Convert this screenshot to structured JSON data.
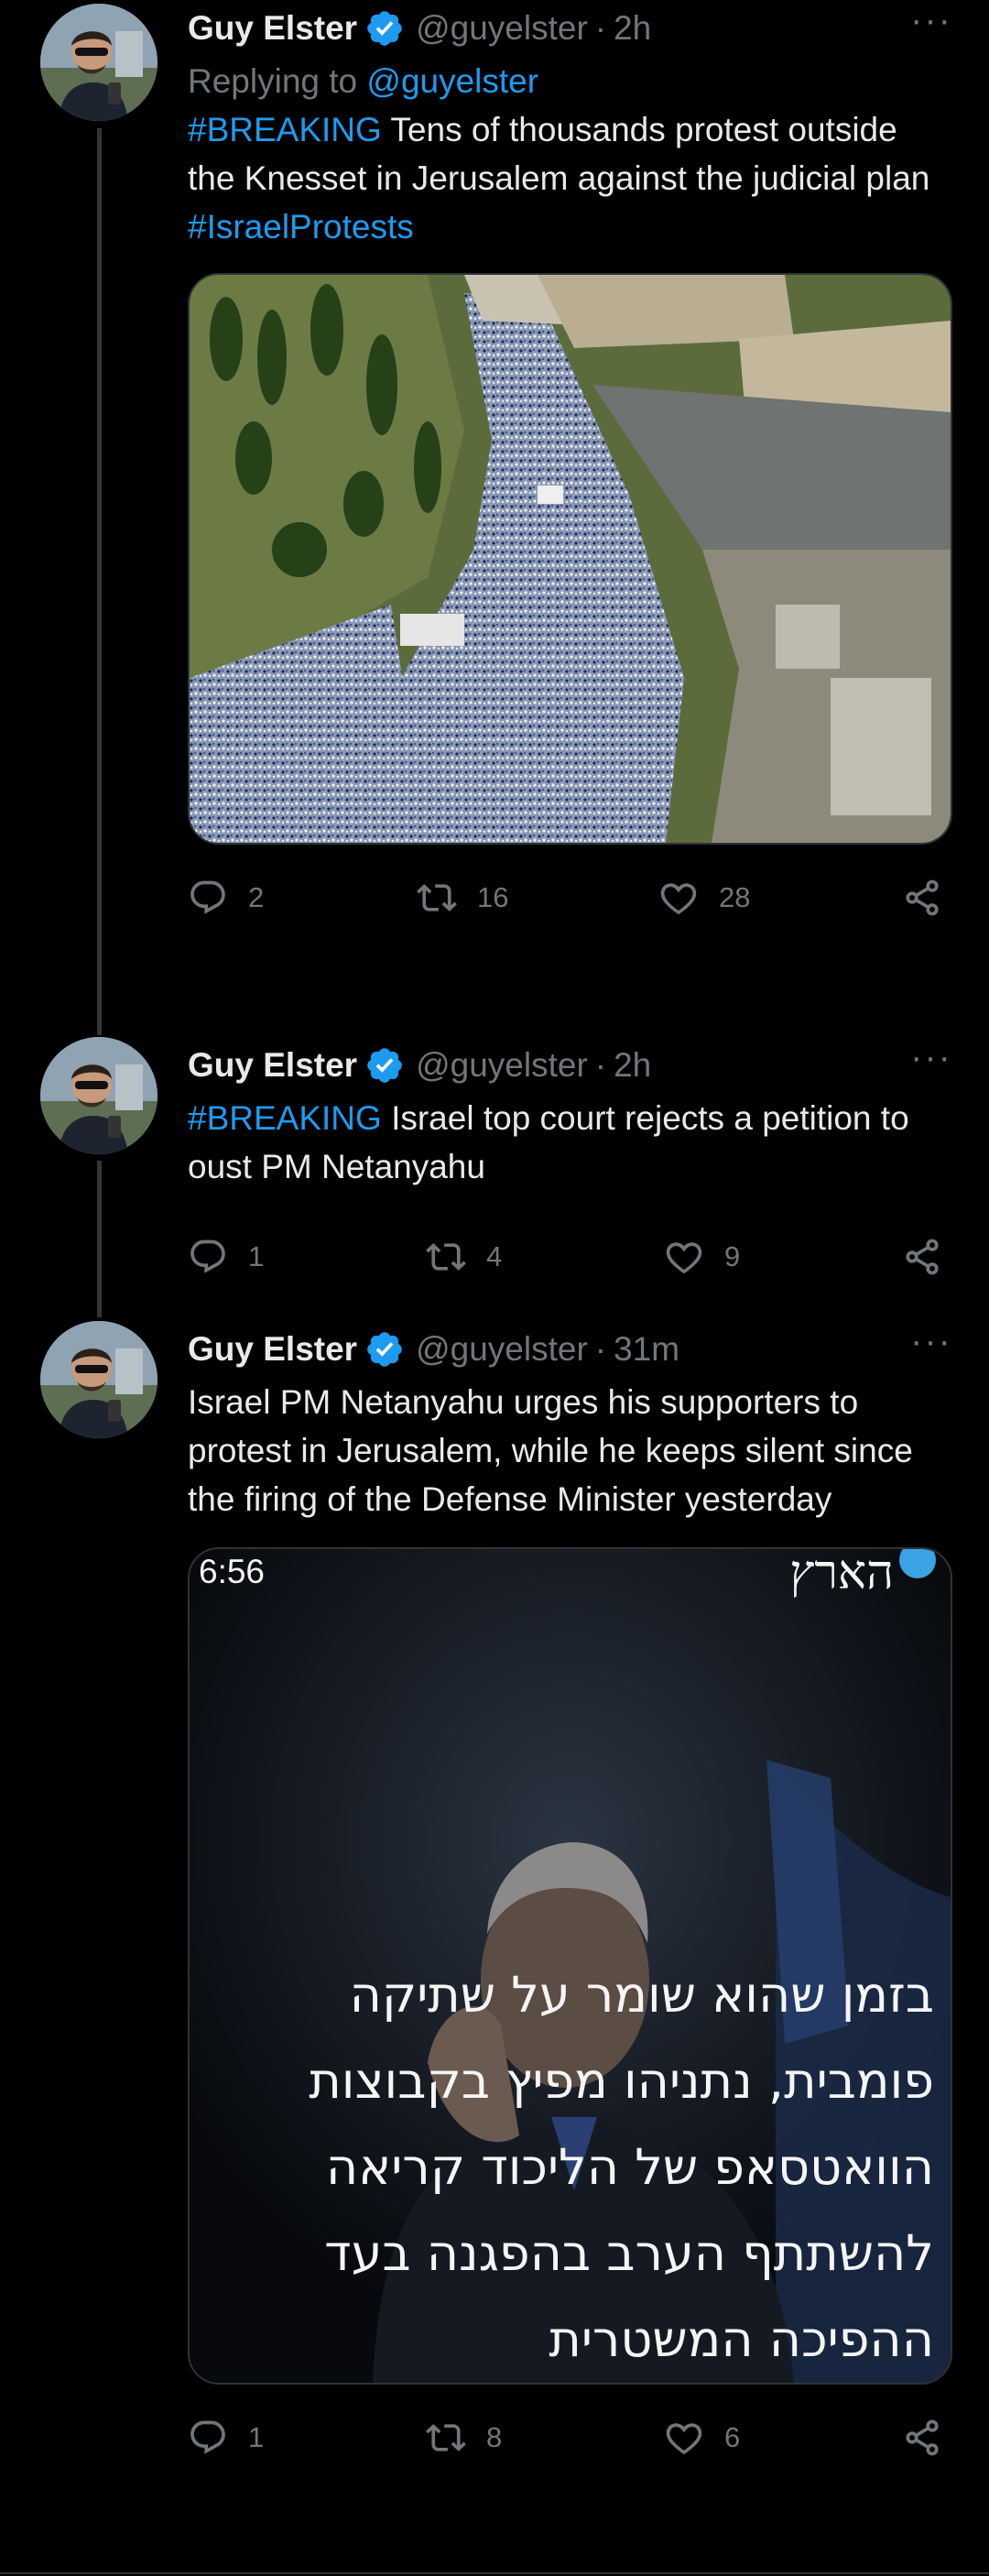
{
  "tweets": [
    {
      "author": {
        "name": "Guy Elster",
        "handle": "@guyelster"
      },
      "time": "2h",
      "reply_prefix": "Replying to",
      "reply_handle": "@guyelster",
      "hashtag": "#BREAKING",
      "text": " Tens of thousands protest outside the Knesset in Jerusalem against the judicial plan",
      "hashtag2": "#IsraelProtests",
      "stats": {
        "replies": "2",
        "retweets": "16",
        "likes": "28"
      }
    },
    {
      "author": {
        "name": "Guy Elster",
        "handle": "@guyelster"
      },
      "time": "2h",
      "hashtag": "#BREAKING",
      "text": " Israel top court rejects a petition to oust PM Netanyahu",
      "stats": {
        "replies": "1",
        "retweets": "4",
        "likes": "9"
      }
    },
    {
      "author": {
        "name": "Guy Elster",
        "handle": "@guyelster"
      },
      "time": "31m",
      "text": "Israel PM Netanyahu urges his supporters to protest in Jerusalem, while he keeps silent since the firing of the Defense Minister yesterday",
      "media": {
        "timestamp": "6:56",
        "brand": "הארץ",
        "caption_lines": [
          "בזמן שהוא שומר על שתיקה",
          "פומבית, נתניהו מפיץ בקבוצות",
          "הוואטסאפ של הליכוד קריאה",
          "להשתתף הערב בהפגנה בעד",
          "ההפיכה המשטרית"
        ]
      },
      "stats": {
        "replies": "1",
        "retweets": "8",
        "likes": "6"
      }
    }
  ],
  "ui": {
    "dot": "·",
    "more": "···"
  },
  "colors": {
    "accent": "#1d9bf0",
    "muted": "#71767b",
    "text": "#e7e9ea",
    "background": "#000000"
  },
  "icons": [
    "verified-badge-icon",
    "reply-icon",
    "retweet-icon",
    "like-icon",
    "share-icon",
    "more-icon"
  ]
}
